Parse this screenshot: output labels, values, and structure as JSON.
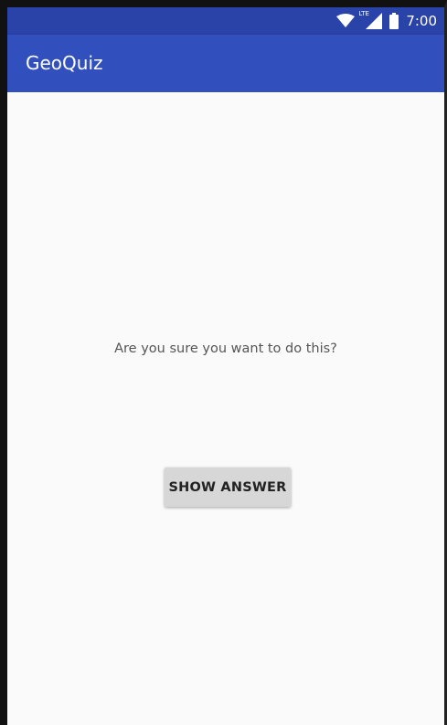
{
  "status_bar": {
    "network_label": "LTE",
    "time": "7:00",
    "icons": [
      "wifi-icon",
      "cellular-signal-icon",
      "battery-icon"
    ]
  },
  "app_bar": {
    "title": "GeoQuiz"
  },
  "main": {
    "warning_text": "Are you sure you want to do this?",
    "show_answer_label": "SHOW ANSWER"
  },
  "colors": {
    "status_bar": "#2a43a8",
    "app_bar": "#3150bd",
    "background": "#fafafa",
    "button": "#d7d7d7"
  }
}
